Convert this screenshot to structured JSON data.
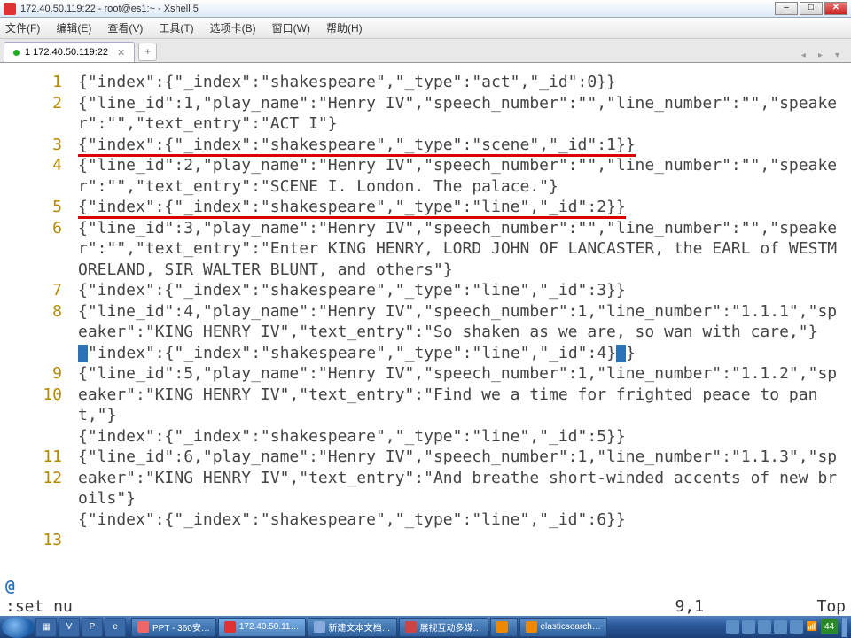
{
  "title": "172.40.50.119:22 - root@es1:~ - Xshell 5",
  "menu": [
    "文件(F)",
    "编辑(E)",
    "查看(V)",
    "工具(T)",
    "选项卡(B)",
    "窗口(W)",
    "帮助(H)"
  ],
  "tab": {
    "label": "1 172.40.50.119:22"
  },
  "newtab": "+",
  "nav_arrows": [
    "◂",
    "▸",
    "▾"
  ],
  "lines": [
    {
      "n": "1",
      "rows": 1,
      "t": "{\"index\":{\"_index\":\"shakespeare\",\"_type\":\"act\",\"_id\":0}}"
    },
    {
      "n": "2",
      "rows": 2,
      "t": "{\"line_id\":1,\"play_name\":\"Henry IV\",\"speech_number\":\"\",\"line_number\":\"\",\"speaker\":\"\",\"text_entry\":\"ACT I\"}"
    },
    {
      "n": "3",
      "rows": 1,
      "t": "{\"index\":{\"_index\":\"shakespeare\",\"_type\":\"scene\",\"_id\":1}}",
      "ul": true
    },
    {
      "n": "4",
      "rows": 2,
      "t": "{\"line_id\":2,\"play_name\":\"Henry IV\",\"speech_number\":\"\",\"line_number\":\"\",\"speaker\":\"\",\"text_entry\":\"SCENE I. London. The palace.\"}"
    },
    {
      "n": "5",
      "rows": 1,
      "t": "{\"index\":{\"_index\":\"shakespeare\",\"_type\":\"line\",\"_id\":2}}",
      "ul": true
    },
    {
      "n": "6",
      "rows": 3,
      "t": "{\"line_id\":3,\"play_name\":\"Henry IV\",\"speech_number\":\"\",\"line_number\":\"\",\"speaker\":\"\",\"text_entry\":\"Enter KING HENRY, LORD JOHN OF LANCASTER, the EARL of WESTMORELAND, SIR WALTER BLUNT, and others\"}"
    },
    {
      "n": "7",
      "rows": 1,
      "t": "{\"index\":{\"_index\":\"shakespeare\",\"_type\":\"line\",\"_id\":3}}"
    },
    {
      "n": "8",
      "rows": 3,
      "t": "{\"line_id\":4,\"play_name\":\"Henry IV\",\"speech_number\":1,\"line_number\":\"1.1.1\",\"speaker\":\"KING HENRY IV\",\"text_entry\":\"So shaken as we are, so wan with care,\"}"
    },
    {
      "n": "9",
      "rows": 1,
      "cursor": true,
      "t_pre": "{",
      "t_mid": "\"index\":{\"_index\":\"shakespeare\",\"_type\":\"line\",\"_id\":4}",
      "t_post": "}"
    },
    {
      "n": "10",
      "rows": 3,
      "t": "{\"line_id\":5,\"play_name\":\"Henry IV\",\"speech_number\":1,\"line_number\":\"1.1.2\",\"speaker\":\"KING HENRY IV\",\"text_entry\":\"Find we a time for frighted peace to pant,\"}"
    },
    {
      "n": "11",
      "rows": 1,
      "t": "{\"index\":{\"_index\":\"shakespeare\",\"_type\":\"line\",\"_id\":5}}"
    },
    {
      "n": "12",
      "rows": 3,
      "t": "{\"line_id\":6,\"play_name\":\"Henry IV\",\"speech_number\":1,\"line_number\":\"1.1.3\",\"speaker\":\"KING HENRY IV\",\"text_entry\":\"And breathe short-winded accents of new broils\"}"
    },
    {
      "n": "13",
      "rows": 1,
      "t": "{\"index\":{\"_index\":\"shakespeare\",\"_type\":\"line\",\"_id\":6}}"
    }
  ],
  "prompt": "@",
  "status": {
    "cmd": ":set nu",
    "pos": "9,1",
    "pct": "Top"
  },
  "quicklaunch": [
    "▦",
    "V",
    "P",
    "e"
  ],
  "tasks": [
    {
      "label": "PPT - 360安…",
      "ico": "#e66"
    },
    {
      "label": "172.40.50.11…",
      "ico": "#d33",
      "active": true
    },
    {
      "label": "新建文本文档…",
      "ico": "#8ad"
    },
    {
      "label": "展视互动多媒…",
      "ico": "#c44"
    },
    {
      "label": "",
      "ico": "#e80"
    },
    {
      "label": "elasticsearch…",
      "ico": "#e80"
    }
  ],
  "tray": {
    "icons": 5,
    "clock": "44"
  }
}
